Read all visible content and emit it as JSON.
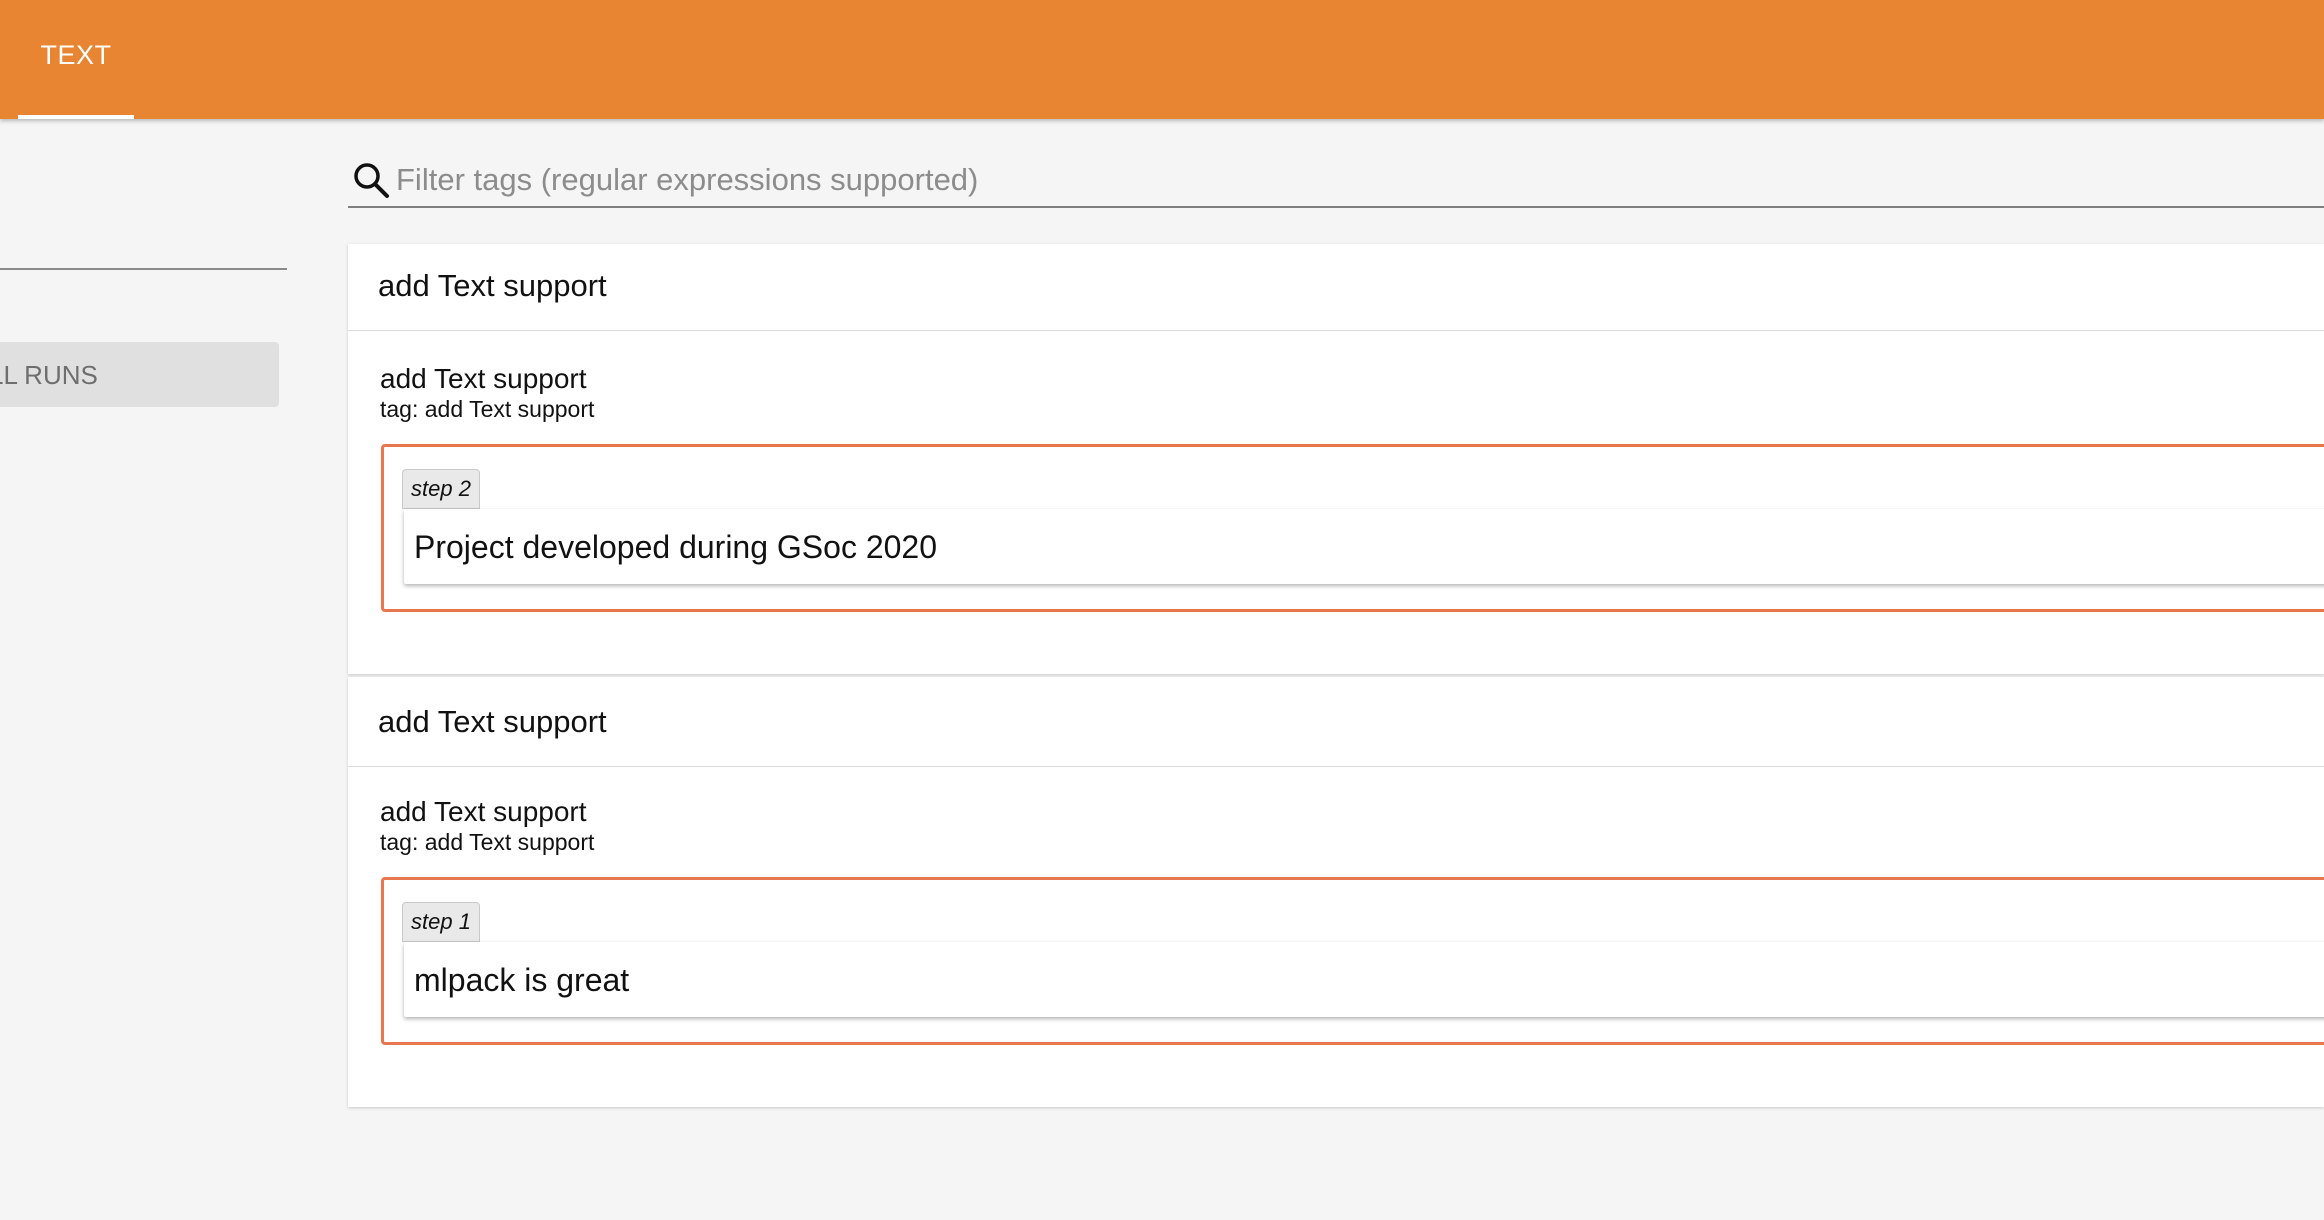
{
  "header": {
    "tabs": [
      {
        "label": "TEXT",
        "active": true
      }
    ],
    "accent_color": "#e88533"
  },
  "sidebar": {
    "filter_partial_text": "s",
    "toggle_partial_label": "LL RUNS"
  },
  "search": {
    "placeholder": "Filter tags (regular expressions supported)",
    "value": ""
  },
  "categories": [
    {
      "title": "add Text support",
      "card": {
        "title": "add Text support",
        "tag": "tag: add Text support",
        "step": "step 2",
        "text": "Project developed during GSoc 2020"
      }
    },
    {
      "title": "add Text support",
      "card": {
        "title": "add Text support",
        "tag": "tag: add Text support",
        "step": "step 1",
        "text": "mlpack is great"
      }
    }
  ],
  "colors": {
    "run_border": "#e8764f",
    "background": "#f5f5f5"
  }
}
